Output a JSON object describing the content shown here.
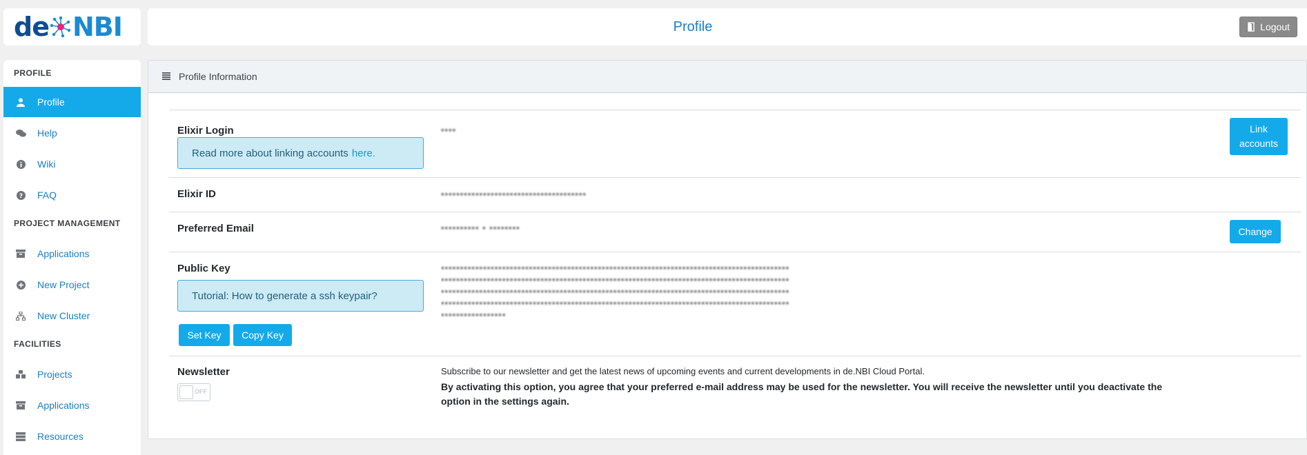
{
  "logo": {
    "part1": "de",
    "part2": "NBI"
  },
  "header": {
    "title": "Profile",
    "logout_label": "Logout"
  },
  "sidebar": {
    "sections": [
      {
        "heading": "PROFILE",
        "items": [
          {
            "label": "Profile",
            "icon": "user-icon",
            "active": true
          },
          {
            "label": "Help",
            "icon": "comments-icon"
          },
          {
            "label": "Wiki",
            "icon": "info-icon"
          },
          {
            "label": "FAQ",
            "icon": "question-icon"
          }
        ]
      },
      {
        "heading": "PROJECT MANAGEMENT",
        "items": [
          {
            "label": "Applications",
            "icon": "archive-icon"
          },
          {
            "label": "New Project",
            "icon": "plus-circle-icon"
          },
          {
            "label": "New Cluster",
            "icon": "sitemap-icon"
          }
        ]
      },
      {
        "heading": "FACILITIES",
        "items": [
          {
            "label": "Projects",
            "icon": "cubes-icon"
          },
          {
            "label": "Applications",
            "icon": "archive-icon"
          },
          {
            "label": "Resources",
            "icon": "server-icon"
          }
        ]
      }
    ]
  },
  "card": {
    "title": "Profile Information",
    "elixir_login": {
      "label": "Elixir Login",
      "value": "••••",
      "info_text": "Read more about linking accounts",
      "info_link": "here.",
      "button": "Link accounts"
    },
    "elixir_id": {
      "label": "Elixir ID",
      "value": "••••••••••••••••••••••••••••••••••••••"
    },
    "preferred_email": {
      "label": "Preferred Email",
      "value": "•••••••••• • ••••••••",
      "button": "Change"
    },
    "public_key": {
      "label": "Public Key",
      "tutorial": "Tutorial: How to generate a ssh keypair?",
      "set_key": "Set Key",
      "copy_key": "Copy Key",
      "value_lines": [
        "•••••••••••••••••••••••••••••••••••••••••••••••••••••••••••••••••••••••••••••••••••••••••••",
        "•••••••••••••••••••••••••••••••••••••••••••••••••••••••••••••••••••••••••••••••••••••••••••",
        "•••••••••••••••••••••••••••••••••••••••••••••••••••••••••••••••••••••••••••••••••••••••••••",
        "•••••••••••••••••••••••••••••••••••••••••••••••••••••••••••••••••••••••••••••••••••••••••••",
        "•••••••••••••••••"
      ]
    },
    "newsletter": {
      "label": "Newsletter",
      "toggle_text": "OFF",
      "description": "Subscribe to our newsletter and get the latest news of upcoming events and current developments in de.NBI Cloud Portal.",
      "consent": "By activating this option, you agree that your preferred e-mail address may be used for the newsletter. You will receive the newsletter until you deactivate the option in the settings again."
    }
  },
  "colors": {
    "accent": "#14aaea",
    "link": "#1a7fc1",
    "logo_dark": "#0e4d92"
  }
}
